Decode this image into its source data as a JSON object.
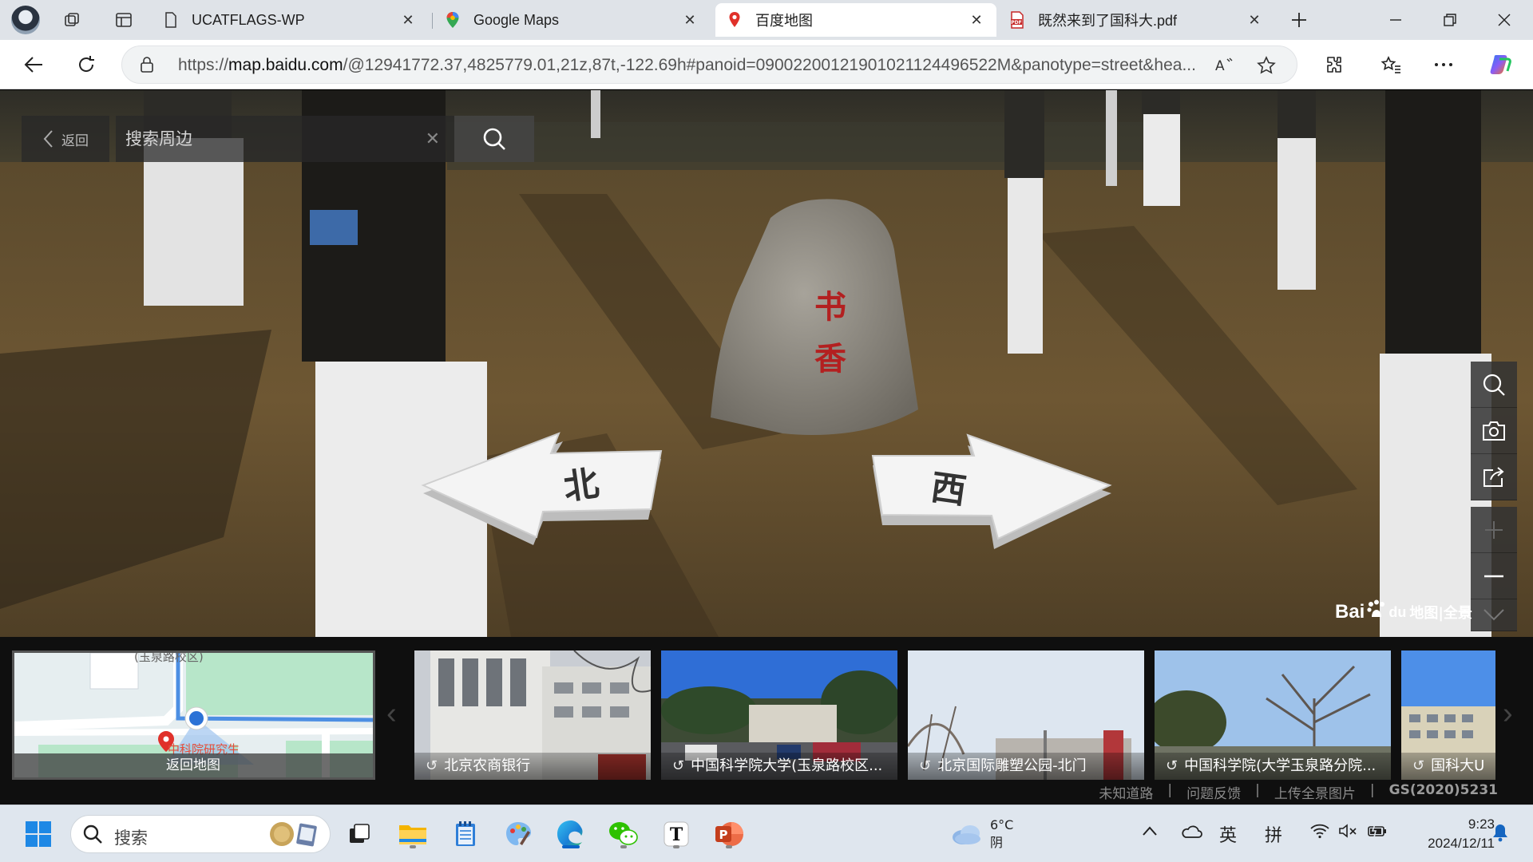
{
  "browser": {
    "tabs": [
      {
        "title": "UCATFLAGS-WP",
        "icon": "page-icon",
        "active": false
      },
      {
        "title": "Google Maps",
        "icon": "google-maps-icon",
        "active": false
      },
      {
        "title": "百度地图",
        "icon": "baidu-map-pin-icon",
        "active": true
      },
      {
        "title": "既然来到了国科大.pdf",
        "icon": "pdf-icon",
        "active": false
      }
    ],
    "url_prefix": "https://",
    "url_host": "map.baidu.com",
    "url_rest": "/@12941772.37,4825779.01,21z,87t,-122.69h#panoid=09002200121901021124496522M&panotype=street&hea..."
  },
  "streetview": {
    "back_label": "返回",
    "search_placeholder": "搜索周边",
    "arrows": {
      "left_label": "北",
      "right_label": "西"
    },
    "logo_text": "Bai",
    "logo_text2": "du",
    "logo_suffix": "地图|全景"
  },
  "strip": {
    "minimap": {
      "campus_label": "(玉泉路校区)",
      "poi_label": "中科院研究生",
      "caption": "返回地图"
    },
    "thumbnails": [
      {
        "caption": "北京农商银行"
      },
      {
        "caption": "中国科学院大学(玉泉路校区..."
      },
      {
        "caption": "北京国际雕塑公园-北门"
      },
      {
        "caption": "中国科学院(大学玉泉路分院..."
      },
      {
        "caption": "国科大U"
      }
    ],
    "footer": {
      "unknown_road": "未知道路",
      "feedback": "问题反馈",
      "upload": "上传全景图片",
      "license": "GS(2020)5231",
      "sep": "|"
    }
  },
  "taskbar": {
    "search_label": "搜索",
    "weather_temp": "6°C",
    "weather_desc": "阴",
    "ime_lang": "英",
    "ime_mode": "拼",
    "time": "9:23",
    "date": "2024/12/11"
  },
  "colors": {
    "edge_accent": "#0a64c8",
    "tabstrip_bg": "#dfe3e8",
    "taskbar_bg": "#dfe6ee"
  }
}
